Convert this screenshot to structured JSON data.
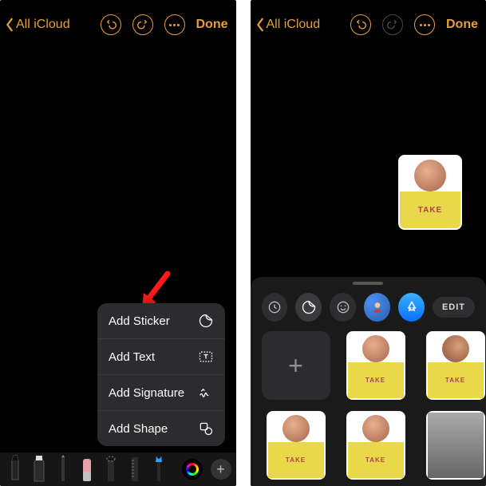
{
  "left": {
    "back_label": "All iCloud",
    "done_label": "Done",
    "menu": {
      "add_sticker": "Add Sticker",
      "add_text": "Add Text",
      "add_signature": "Add Signature",
      "add_shape": "Add Shape"
    }
  },
  "right": {
    "back_label": "All iCloud",
    "done_label": "Done",
    "edit_label": "EDIT",
    "sticker_text": "TAKE"
  }
}
